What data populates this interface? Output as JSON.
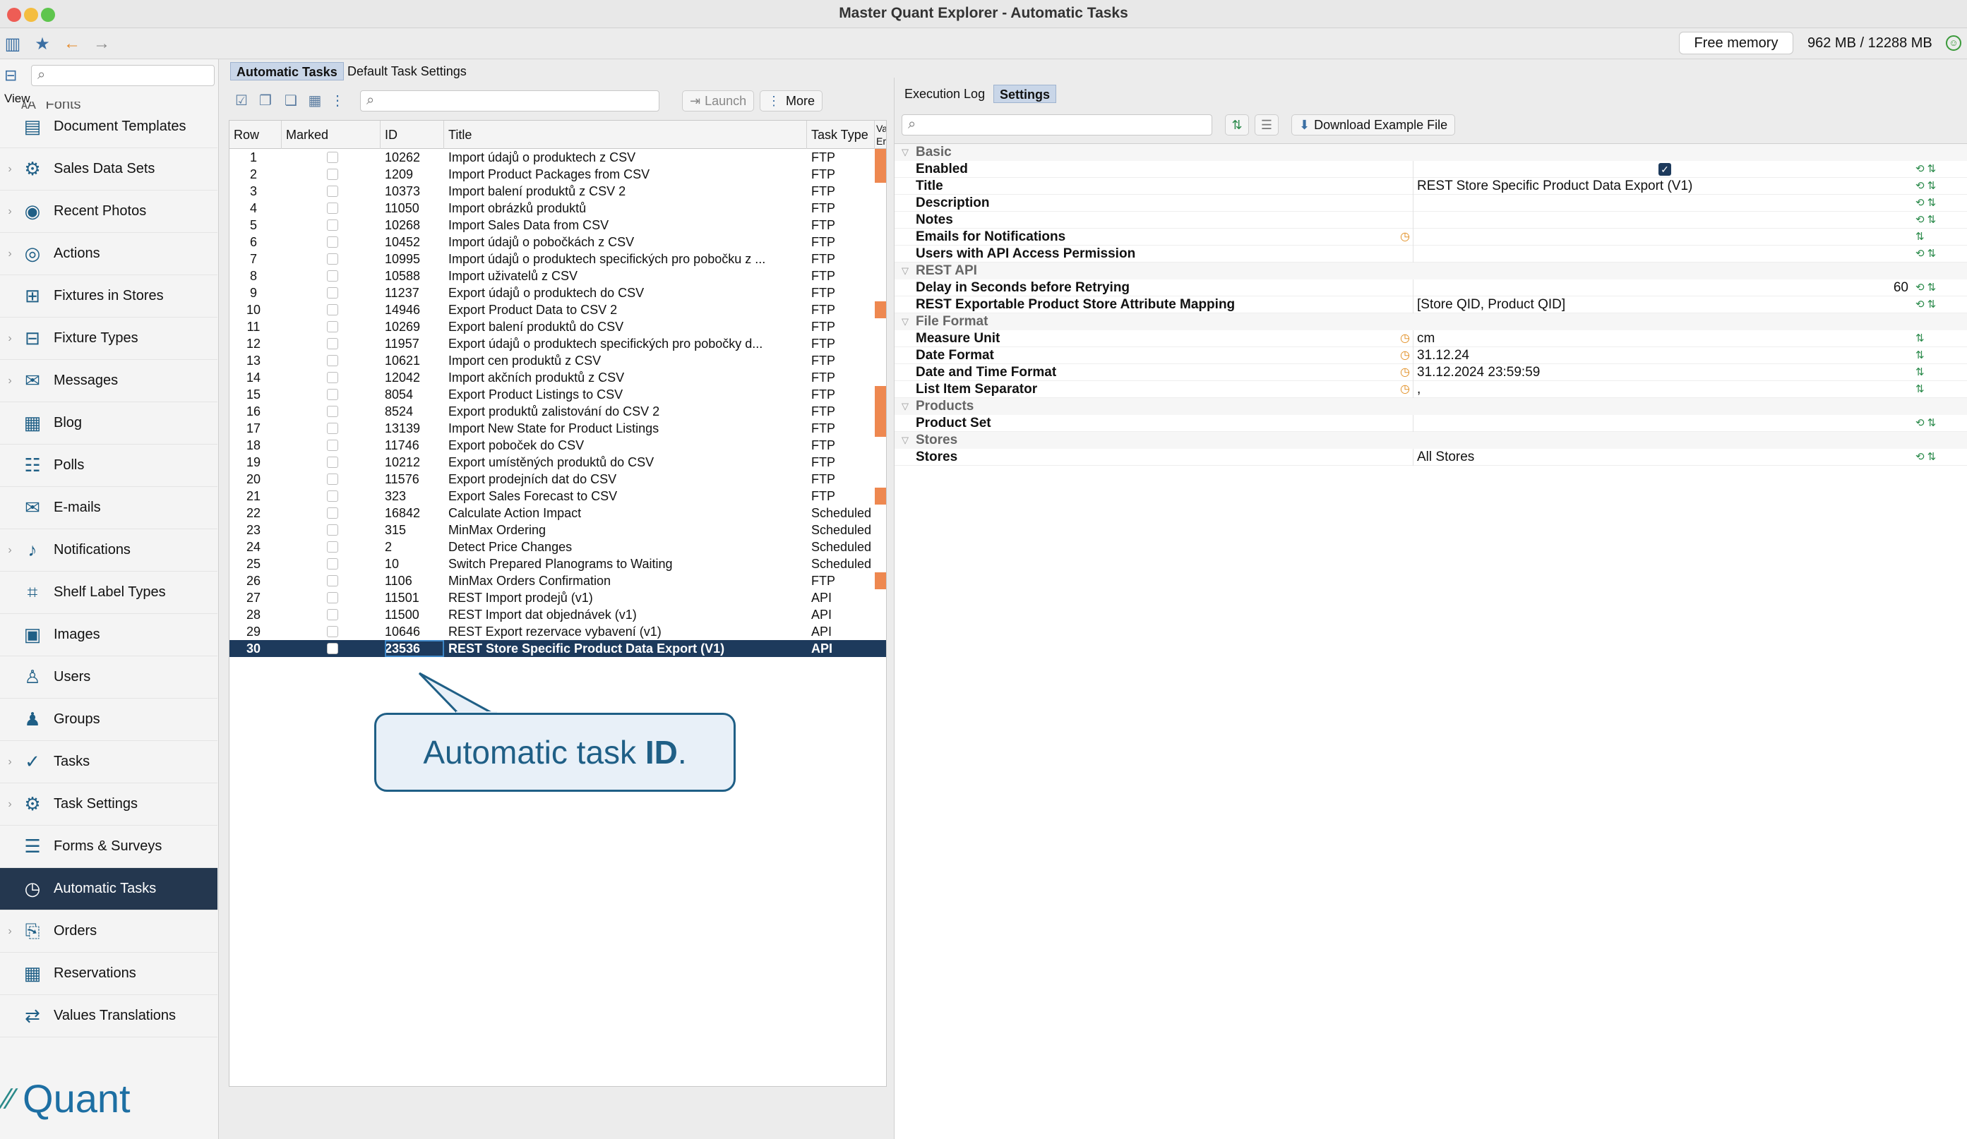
{
  "window": {
    "title": "Master Quant Explorer - Automatic Tasks",
    "free_memory_label": "Free memory",
    "memory_value": "962 MB / 12288 MB"
  },
  "sidebar": {
    "view_label": "View",
    "partial_item": "Fonts",
    "items": [
      {
        "label": "Document Templates",
        "icon": "document-templates-icon",
        "chevron": false
      },
      {
        "label": "Sales Data Sets",
        "icon": "sales-data-sets-icon",
        "chevron": true
      },
      {
        "label": "Recent Photos",
        "icon": "camera-icon",
        "chevron": true
      },
      {
        "label": "Actions",
        "icon": "actions-icon",
        "chevron": true
      },
      {
        "label": "Fixtures in Stores",
        "icon": "fixtures-icon",
        "chevron": false
      },
      {
        "label": "Fixture Types",
        "icon": "fixture-types-icon",
        "chevron": true
      },
      {
        "label": "Messages",
        "icon": "messages-icon",
        "chevron": true
      },
      {
        "label": "Blog",
        "icon": "blog-icon",
        "chevron": false
      },
      {
        "label": "Polls",
        "icon": "polls-icon",
        "chevron": false
      },
      {
        "label": "E-mails",
        "icon": "email-icon",
        "chevron": false
      },
      {
        "label": "Notifications",
        "icon": "bell-icon",
        "chevron": true
      },
      {
        "label": "Shelf Label Types",
        "icon": "label-icon",
        "chevron": false
      },
      {
        "label": "Images",
        "icon": "images-icon",
        "chevron": false
      },
      {
        "label": "Users",
        "icon": "user-icon",
        "chevron": false
      },
      {
        "label": "Groups",
        "icon": "groups-icon",
        "chevron": false
      },
      {
        "label": "Tasks",
        "icon": "tasks-icon",
        "chevron": true
      },
      {
        "label": "Task Settings",
        "icon": "task-settings-icon",
        "chevron": true
      },
      {
        "label": "Forms & Surveys",
        "icon": "forms-icon",
        "chevron": false
      },
      {
        "label": "Automatic Tasks",
        "icon": "automatic-tasks-icon",
        "chevron": false
      },
      {
        "label": "Orders",
        "icon": "orders-icon",
        "chevron": true
      },
      {
        "label": "Reservations",
        "icon": "calendar-icon",
        "chevron": false
      },
      {
        "label": "Values Translations",
        "icon": "translations-icon",
        "chevron": false
      }
    ],
    "logo_text": "Quant"
  },
  "middle": {
    "tabs": [
      "Automatic Tasks",
      "Default Task Settings"
    ],
    "launch_label": "Launch",
    "more_label": "More",
    "columns": [
      "Row",
      "Marked",
      "ID",
      "Title",
      "Task Type",
      "Va Er"
    ],
    "rows": [
      {
        "row": "1",
        "id": "10262",
        "title": "Import údajů o produktech z CSV",
        "type": "FTP",
        "flag": true
      },
      {
        "row": "2",
        "id": "1209",
        "title": "Import Product Packages from CSV",
        "type": "FTP",
        "flag": true
      },
      {
        "row": "3",
        "id": "10373",
        "title": "Import balení produktů z CSV 2",
        "type": "FTP",
        "flag": false
      },
      {
        "row": "4",
        "id": "11050",
        "title": "Import obrázků produktů",
        "type": "FTP",
        "flag": false
      },
      {
        "row": "5",
        "id": "10268",
        "title": "Import Sales Data from CSV",
        "type": "FTP",
        "flag": false
      },
      {
        "row": "6",
        "id": "10452",
        "title": "Import údajů o pobočkách z CSV",
        "type": "FTP",
        "flag": false
      },
      {
        "row": "7",
        "id": "10995",
        "title": "Import údajů o produktech specifických pro pobočku z ...",
        "type": "FTP",
        "flag": false
      },
      {
        "row": "8",
        "id": "10588",
        "title": "Import uživatelů z CSV",
        "type": "FTP",
        "flag": false
      },
      {
        "row": "9",
        "id": "11237",
        "title": "Export údajů o produktech do CSV",
        "type": "FTP",
        "flag": false
      },
      {
        "row": "10",
        "id": "14946",
        "title": "Export Product Data to CSV 2",
        "type": "FTP",
        "flag": true
      },
      {
        "row": "11",
        "id": "10269",
        "title": "Export balení produktů do CSV",
        "type": "FTP",
        "flag": false
      },
      {
        "row": "12",
        "id": "11957",
        "title": "Export údajů o produktech specifických pro pobočky d...",
        "type": "FTP",
        "flag": false
      },
      {
        "row": "13",
        "id": "10621",
        "title": "Import cen produktů z CSV",
        "type": "FTP",
        "flag": false
      },
      {
        "row": "14",
        "id": "12042",
        "title": "Import akčních produktů z CSV",
        "type": "FTP",
        "flag": false
      },
      {
        "row": "15",
        "id": "8054",
        "title": "Export Product Listings to CSV",
        "type": "FTP",
        "flag": true
      },
      {
        "row": "16",
        "id": "8524",
        "title": "Export produktů zalistování do CSV 2",
        "type": "FTP",
        "flag": true
      },
      {
        "row": "17",
        "id": "13139",
        "title": "Import New State for Product Listings",
        "type": "FTP",
        "flag": true
      },
      {
        "row": "18",
        "id": "11746",
        "title": "Export poboček do CSV",
        "type": "FTP",
        "flag": false
      },
      {
        "row": "19",
        "id": "10212",
        "title": "Export umístěných produktů do CSV",
        "type": "FTP",
        "flag": false
      },
      {
        "row": "20",
        "id": "11576",
        "title": "Export prodejních dat do CSV",
        "type": "FTP",
        "flag": false
      },
      {
        "row": "21",
        "id": "323",
        "title": "Export Sales Forecast to CSV",
        "type": "FTP",
        "flag": true
      },
      {
        "row": "22",
        "id": "16842",
        "title": "Calculate Action Impact",
        "type": "Scheduled",
        "flag": false
      },
      {
        "row": "23",
        "id": "315",
        "title": "MinMax Ordering",
        "type": "Scheduled",
        "flag": false
      },
      {
        "row": "24",
        "id": "2",
        "title": "Detect Price Changes",
        "type": "Scheduled",
        "flag": false
      },
      {
        "row": "25",
        "id": "10",
        "title": "Switch Prepared Planograms to Waiting",
        "type": "Scheduled",
        "flag": false
      },
      {
        "row": "26",
        "id": "1106",
        "title": "MinMax Orders Confirmation",
        "type": "FTP",
        "flag": true
      },
      {
        "row": "27",
        "id": "11501",
        "title": "REST Import prodejů (v1)",
        "type": "API",
        "flag": false
      },
      {
        "row": "28",
        "id": "11500",
        "title": "REST Import dat objednávek (v1)",
        "type": "API",
        "flag": false
      },
      {
        "row": "29",
        "id": "10646",
        "title": "REST Export rezervace vybavení (v1)",
        "type": "API",
        "flag": false
      },
      {
        "row": "30",
        "id": "23536",
        "title": "REST Store Specific Product Data Export (V1)",
        "type": "API",
        "flag": false,
        "selected": true
      }
    ]
  },
  "callout": {
    "prefix": "Automatic task ",
    "bold": "ID",
    "suffix": "."
  },
  "right": {
    "tabs": [
      "Execution Log",
      "Settings"
    ],
    "download_label": "Download Example File",
    "properties": [
      {
        "section": true,
        "name": "Basic"
      },
      {
        "name": "Enabled",
        "value": "",
        "checkbox": true
      },
      {
        "name": "Title",
        "value": "REST Store Specific Product Data Export (V1)"
      },
      {
        "name": "Description",
        "value": ""
      },
      {
        "name": "Notes",
        "value": ""
      },
      {
        "name": "Emails for Notifications",
        "value": "",
        "warn": true
      },
      {
        "name": "Users with API Access Permission",
        "value": ""
      },
      {
        "section": true,
        "name": "REST API"
      },
      {
        "name": "Delay in Seconds before Retrying",
        "value": "60",
        "right": true
      },
      {
        "name": "REST Exportable Product Store Attribute Mapping",
        "value": "[Store QID, Product QID]"
      },
      {
        "section": true,
        "name": "File Format"
      },
      {
        "name": "Measure Unit",
        "value": "cm",
        "warn": true
      },
      {
        "name": "Date Format",
        "value": "31.12.24",
        "warn": true
      },
      {
        "name": "Date and Time Format",
        "value": "31.12.2024 23:59:59",
        "warn": true
      },
      {
        "name": "List Item Separator",
        "value": ",",
        "warn": true
      },
      {
        "section": true,
        "name": "Products"
      },
      {
        "name": "Product Set",
        "value": ""
      },
      {
        "section": true,
        "name": "Stores"
      },
      {
        "name": "Stores",
        "value": "All Stores"
      }
    ]
  },
  "colors": {
    "accent": "#1d3a5c",
    "brand": "#1d6fa3",
    "flag": "#ee8850",
    "callout_border": "#1f5f86"
  }
}
